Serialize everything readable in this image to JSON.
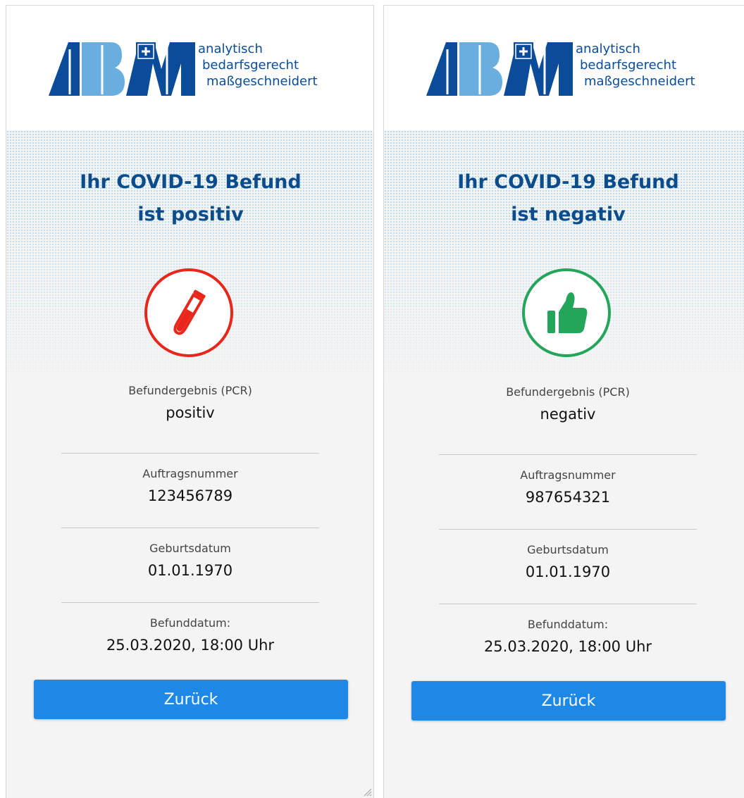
{
  "panels": [
    {
      "logo": {
        "tagline_1": "analytisch",
        "tagline_2": "bedarfsgerecht",
        "tagline_3": "maßgeschneidert"
      },
      "title_line_1": "Ihr COVID-19 Befund",
      "title_line_2": "ist positiv",
      "status_icon": "test-tube-icon",
      "status_color": "#e9261b",
      "fields": [
        {
          "label": "Befundergebnis (PCR)",
          "value": "positiv"
        },
        {
          "label": "Auftragsnummer",
          "value": "123456789"
        },
        {
          "label": "Geburtsdatum",
          "value": "01.01.1970"
        },
        {
          "label": "Befunddatum:",
          "value": "25.03.2020, 18:00 Uhr"
        }
      ],
      "back_label": "Zurück"
    },
    {
      "logo": {
        "tagline_1": "analytisch",
        "tagline_2": "bedarfsgerecht",
        "tagline_3": "maßgeschneidert"
      },
      "title_line_1": "Ihr COVID-19 Befund",
      "title_line_2": "ist negativ",
      "status_icon": "thumbs-up-icon",
      "status_color": "#23a55a",
      "fields": [
        {
          "label": "Befundergebnis (PCR)",
          "value": "negativ"
        },
        {
          "label": "Auftragsnummer",
          "value": "987654321"
        },
        {
          "label": "Geburtsdatum",
          "value": "01.01.1970"
        },
        {
          "label": "Befunddatum:",
          "value": "25.03.2020, 18:00 Uhr"
        }
      ],
      "back_label": "Zurück"
    }
  ],
  "colors": {
    "brand_dark_blue": "#0a4c99",
    "brand_light_blue": "#6aaee0",
    "title_blue": "#0b4d8c",
    "button_blue": "#1d88e5"
  }
}
